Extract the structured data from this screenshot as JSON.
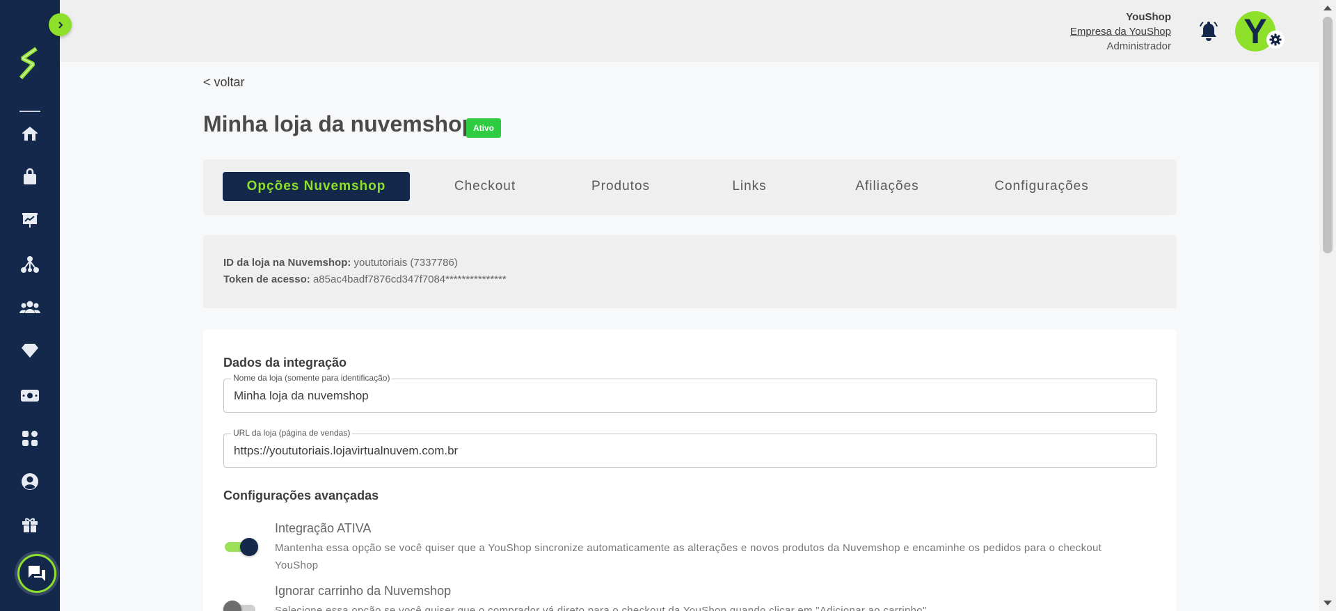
{
  "colors": {
    "sidebar": "#13284a",
    "accent": "#8ee02b",
    "active_badge": "#2ecc40"
  },
  "sidebar": {
    "items": [
      {
        "icon": "home-icon"
      },
      {
        "icon": "shopping-bag-icon"
      },
      {
        "icon": "presentation-chart-icon"
      },
      {
        "icon": "network-icon"
      },
      {
        "icon": "users-icon"
      },
      {
        "icon": "diamond-icon"
      },
      {
        "icon": "money-icon"
      },
      {
        "icon": "apps-icon"
      },
      {
        "icon": "user-circle-icon"
      },
      {
        "icon": "gift-icon"
      }
    ]
  },
  "header": {
    "user_name": "YouShop",
    "company": "Empresa da YouShop",
    "role": "Administrador",
    "avatar_letter": "Y"
  },
  "page": {
    "back_label": "< voltar",
    "title": "Minha loja da nuvemshop",
    "status": "Ativo"
  },
  "tabs": [
    {
      "label": "Opções Nuvemshop",
      "active": true
    },
    {
      "label": "Checkout",
      "active": false
    },
    {
      "label": "Produtos",
      "active": false
    },
    {
      "label": "Links",
      "active": false
    },
    {
      "label": "Afiliações",
      "active": false
    },
    {
      "label": "Configurações",
      "active": false
    }
  ],
  "info": {
    "store_id_label": "ID da loja na Nuvemshop:",
    "store_id_value": "yoututoriais (7337786)",
    "token_label": "Token de acesso:",
    "token_value": "a85ac4badf7876cd347f7084***************"
  },
  "integration": {
    "section_title": "Dados da integração",
    "store_name_label": "Nome da loja (somente para identificação)",
    "store_name_value": "Minha loja da nuvemshop",
    "store_url_label": "URL da loja (página de vendas)",
    "store_url_value": "https://yoututoriais.lojavirtualnuvem.com.br"
  },
  "advanced": {
    "section_title": "Configurações avançadas",
    "options": [
      {
        "title": "Integração ATIVA",
        "description": "Mantenha essa opção se você quiser que a YouShop sincronize automaticamente as alterações e novos produtos da Nuvemshop e encaminhe os pedidos para o checkout YouShop",
        "enabled": true
      },
      {
        "title": "Ignorar carrinho da Nuvemshop",
        "description": "Selecione essa opção se você quiser que o comprador vá direto para o checkout da YouShop quando clicar em \"Adicionar ao carrinho\"",
        "enabled": false
      }
    ]
  }
}
